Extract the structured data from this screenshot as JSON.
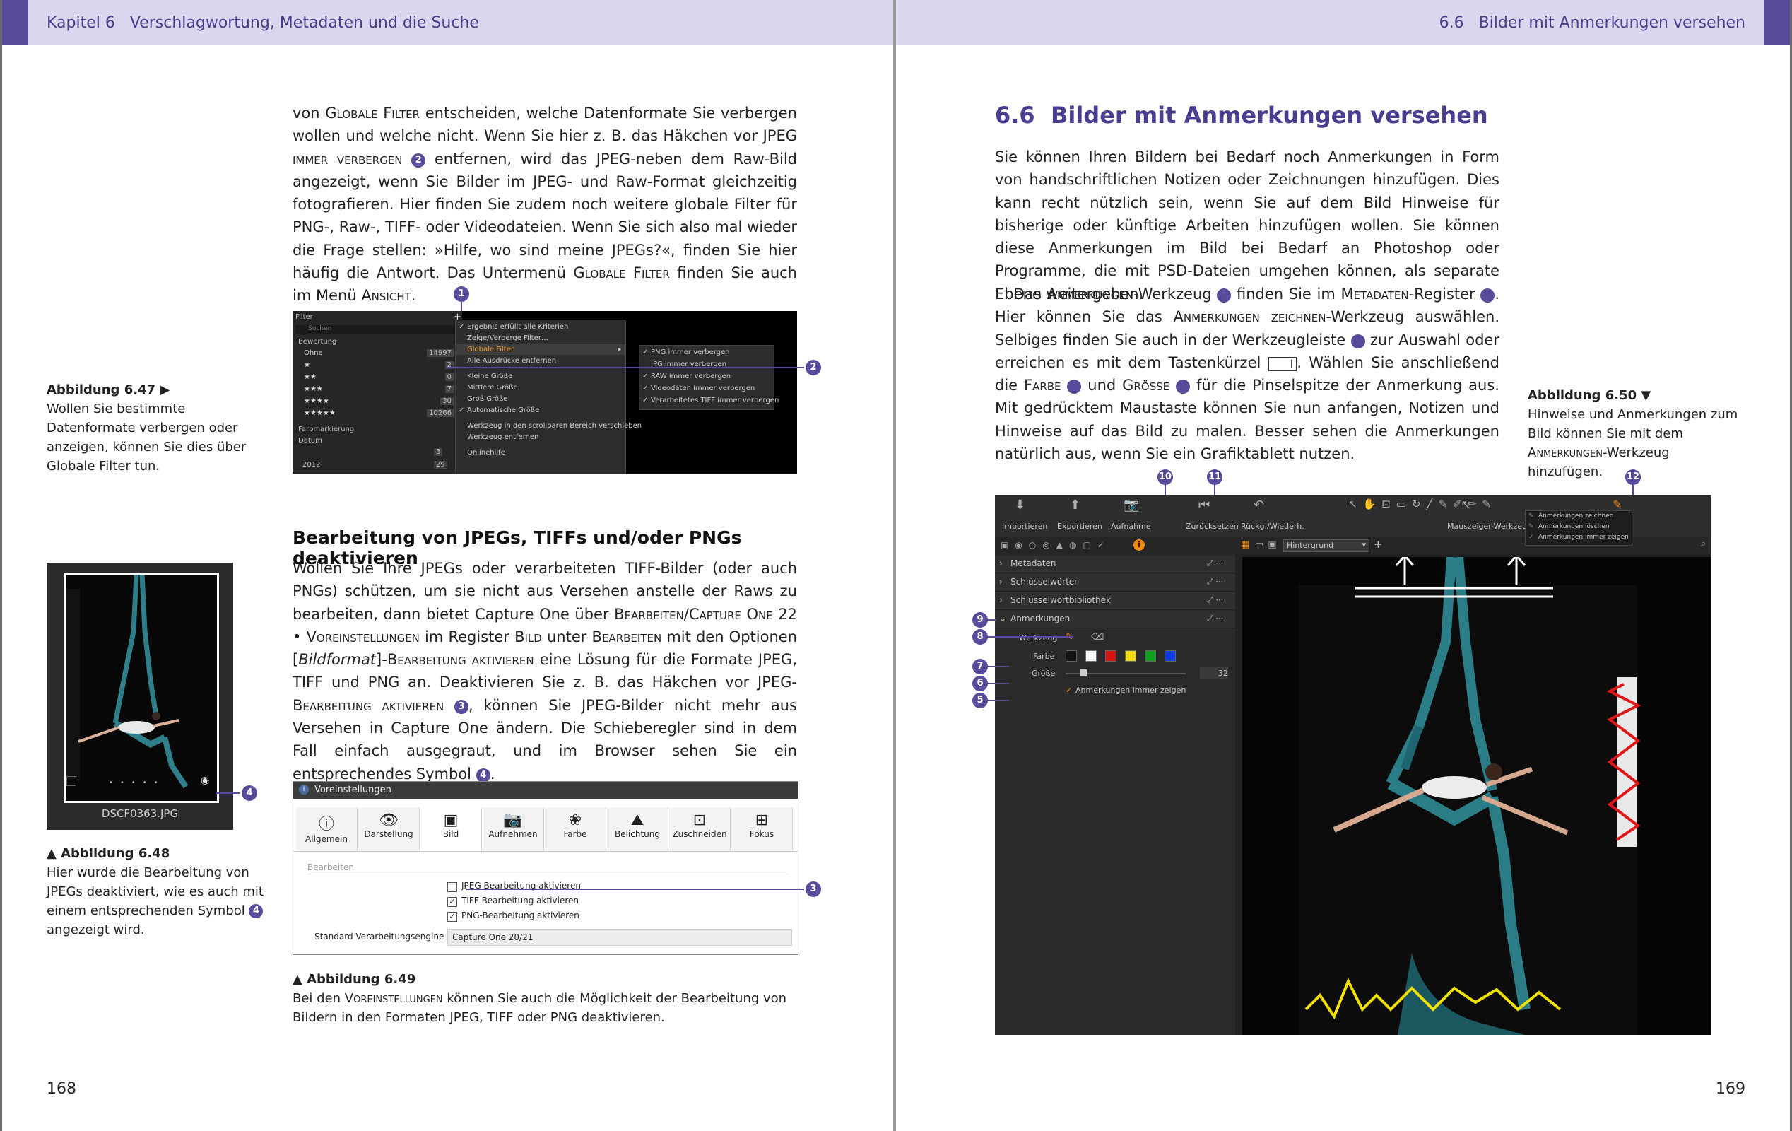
{
  "header_left": {
    "chapter": "Kapitel 6",
    "title": "Verschlagwortung, Metadaten und die Suche"
  },
  "header_right": {
    "number": "6.6",
    "title": "Bilder mit Anmerkungen versehen"
  },
  "left_page_number": "168",
  "right_page_number": "169",
  "left_intro_paragraph": [
    "von ",
    "Globale Filter",
    " entscheiden, welche Datenformate Sie verbergen wollen und welche nicht. Wenn Sie hier z. B. das Häkchen vor ",
    "JPEG immer verbergen",
    "2",
    " entfernen, wird das JPEG-neben dem Raw-Bild angezeigt, wenn Sie Bilder im JPEG- und Raw-Format gleichzeitig fotografieren. Hier finden Sie zudem noch weitere globale Filter für PNG-, Raw-, TIFF- oder Videodateien. Wenn Sie sich also mal wieder die Frage stellen: »Hilfe, wo sind meine JPEGs?«, finden Sie hier häufig die Antwort. Das Untermenü ",
    "Globale Filter",
    " finden Sie auch im Menü ",
    "Ansicht",
    "."
  ],
  "fig647": {
    "title": "Abbildung 6.47 ▶",
    "text": "Wollen Sie bestimmte Datenformate verbergen oder anzeigen, können Sie dies über Globale Filter tun.",
    "callout1": "1",
    "callout2": "2",
    "panel": {
      "title": "Filter",
      "search": "Suchen",
      "section": "Bewertung",
      "rows": [
        {
          "label": "Ohne",
          "count": "14997"
        },
        {
          "label": "★",
          "count": "2"
        },
        {
          "label": "★★",
          "count": "0"
        },
        {
          "label": "★★★",
          "count": "7"
        },
        {
          "label": "★★★★",
          "count": "30"
        },
        {
          "label": "★★★★★",
          "count": "10266"
        }
      ],
      "section2": "Farbmarkierung",
      "section3": "Datum",
      "year": "2012",
      "year_count": "29",
      "extra_count": "3"
    },
    "menu": [
      "Ergebnis erfüllt alle Kriterien",
      "Zeige/Verberge Filter…",
      "Globale Filter",
      "Alle Ausdrücke entfernen",
      "Kleine Größe",
      "Mittlere Größe",
      "Groß Größe",
      "Automatische Größe",
      "Werkzeug in den scrollbaren Bereich verschieben",
      "Werkzeug entfernen",
      "Onlinehilfe"
    ],
    "submenu": [
      "PNG immer verbergen",
      "JPG immer verbergen",
      "RAW immer verbergen",
      "Videodaten immer verbergen",
      "Verarbeitetes TIFF immer verbergen"
    ]
  },
  "section_heading": "Bearbeitung von JPEGs, TIFFs und/oder PNGs deaktivieren",
  "section_paragraph": [
    "Wollen Sie Ihre JPEGs oder verarbeiteten TIFF-Bilder (oder auch PNGs) schützen, um sie nicht aus Versehen anstelle der Raws zu bearbeiten, dann bietet Capture One über ",
    "Bearbeiten/Capture One 22 • Voreinstellungen",
    " im Register ",
    "Bild",
    " unter ",
    "Bearbeiten",
    " mit den Optionen [",
    "Bildformat",
    "]-",
    "Bearbeitung aktivieren",
    " eine Lösung für die Formate JPEG, TIFF und PNG an. Deaktivieren Sie z. B. das Häkchen vor ",
    "JPEG-Bearbeitung aktivieren",
    "3",
    ", können Sie JPEG-Bilder nicht mehr aus Versehen in Capture One ändern. Die Schieberegler sind in dem Fall einfach ausgegraut, und im Browser sehen Sie ein entsprechendes Symbol ",
    "4",
    "."
  ],
  "fig648": {
    "title": "▲ Abbildung 6.48",
    "text_before": "Hier wurde die Bearbeitung von JPEGs deaktiviert, wie es auch mit einem entsprechenden Symbol ",
    "num": "4",
    "text_after": " angezeigt wird.",
    "filename": "DSCF0363.JPG",
    "callout": "4"
  },
  "fig649": {
    "title": "▲ Abbildung 6.49",
    "text_before": "Bei den ",
    "sc": "Voreinstellungen",
    "text_after": " können Sie auch die Möglichkeit der Bearbeitung von Bildern in den Formaten JPEG, TIFF oder PNG deaktivieren.",
    "window_title": "Voreinstellungen",
    "tabs": [
      "Allgemein",
      "Darstellung",
      "Bild",
      "Aufnehmen",
      "Farbe",
      "Belichtung",
      "Zuschneiden",
      "Fokus"
    ],
    "tab_icons": [
      "ⓘ",
      "👁",
      "▣",
      "📷",
      "❀",
      "⛰",
      "⊡",
      "⊞"
    ],
    "group": "Bearbeiten",
    "options": [
      "JPEG-Bearbeitung aktivieren",
      "TIFF-Bearbeitung aktivieren",
      "PNG-Bearbeitung aktivieren"
    ],
    "engine_label": "Standard Verarbeitungsengine",
    "engine_value": "Capture One 20/21",
    "callout": "3"
  },
  "right_heading": {
    "number": "6.6",
    "title": "Bilder mit Anmerkungen versehen"
  },
  "right_paragraph1": "Sie können Ihren Bildern bei Bedarf noch Anmerkungen in Form von handschriftlichen Notizen oder Zeichnungen hinzufügen. Dies kann recht nützlich sein, wenn Sie auf dem Bild Hinweise für bisherige oder künftige Arbeiten hinzufügen wollen. Sie können diese Anmerkungen im Bild bei Bedarf an Photoshop oder Programme, die mit PSD-Dateien umgehen können, als separate Ebene weitergeben.",
  "right_paragraph2": [
    "Das ",
    "Anmerkungen",
    "-Werkzeug ",
    "9",
    " finden Sie im ",
    "Metadaten",
    "-Register ",
    "10",
    ". Hier können Sie das ",
    "Anmerkungen zeichnen",
    "-Werkzeug auswählen. Selbiges finden Sie auch in der Werkzeugleiste ",
    "12",
    " zur Auswahl oder erreichen es mit dem Tastenkürzel ",
    "I",
    ". Wählen Sie anschließend die ",
    "Farbe",
    "7",
    " und ",
    "Grösse",
    "6",
    " für die Pinselspitze der Anmerkung aus. Mit gedrücktem Maustaste können Sie nun anfangen, Notizen und Hinweise auf das Bild zu malen. Besser sehen die Anmerkungen natürlich aus, wenn Sie ein Grafiktablett nutzen."
  ],
  "fig650": {
    "title": "Abbildung 6.50 ▼",
    "text_before": "Hinweise und Anmerkungen zum Bild können Sie mit dem ",
    "sc": "Anmerkungen",
    "text_after": "-Werkzeug hinzufügen.",
    "toolbar": [
      "Importieren",
      "Exportieren",
      "Aufnahme",
      "Zurücksetzen",
      "Rückg./Wiederh.",
      "Mauszeiger-Werkzeuge"
    ],
    "panels": [
      "Metadaten",
      "Schlüsselwörter",
      "Schlüsselwortbibliothek",
      "Anmerkungen"
    ],
    "werkzeug": "Werkzeug",
    "farbe": "Farbe",
    "groesse": "Größe",
    "size_value": "32",
    "always_show": "Anmerkungen immer zeigen",
    "layer": "Hintergrund",
    "dropdown": [
      "Anmerkungen zeichnen",
      "Anmerkungen löschen",
      "Anmerkungen immer zeigen"
    ],
    "swatches": [
      "#111111",
      "#ffffff",
      "#e01010",
      "#f0e000",
      "#10a020",
      "#1040e0"
    ],
    "callouts": [
      "5",
      "6",
      "7",
      "8",
      "9",
      "10",
      "11",
      "12"
    ]
  }
}
